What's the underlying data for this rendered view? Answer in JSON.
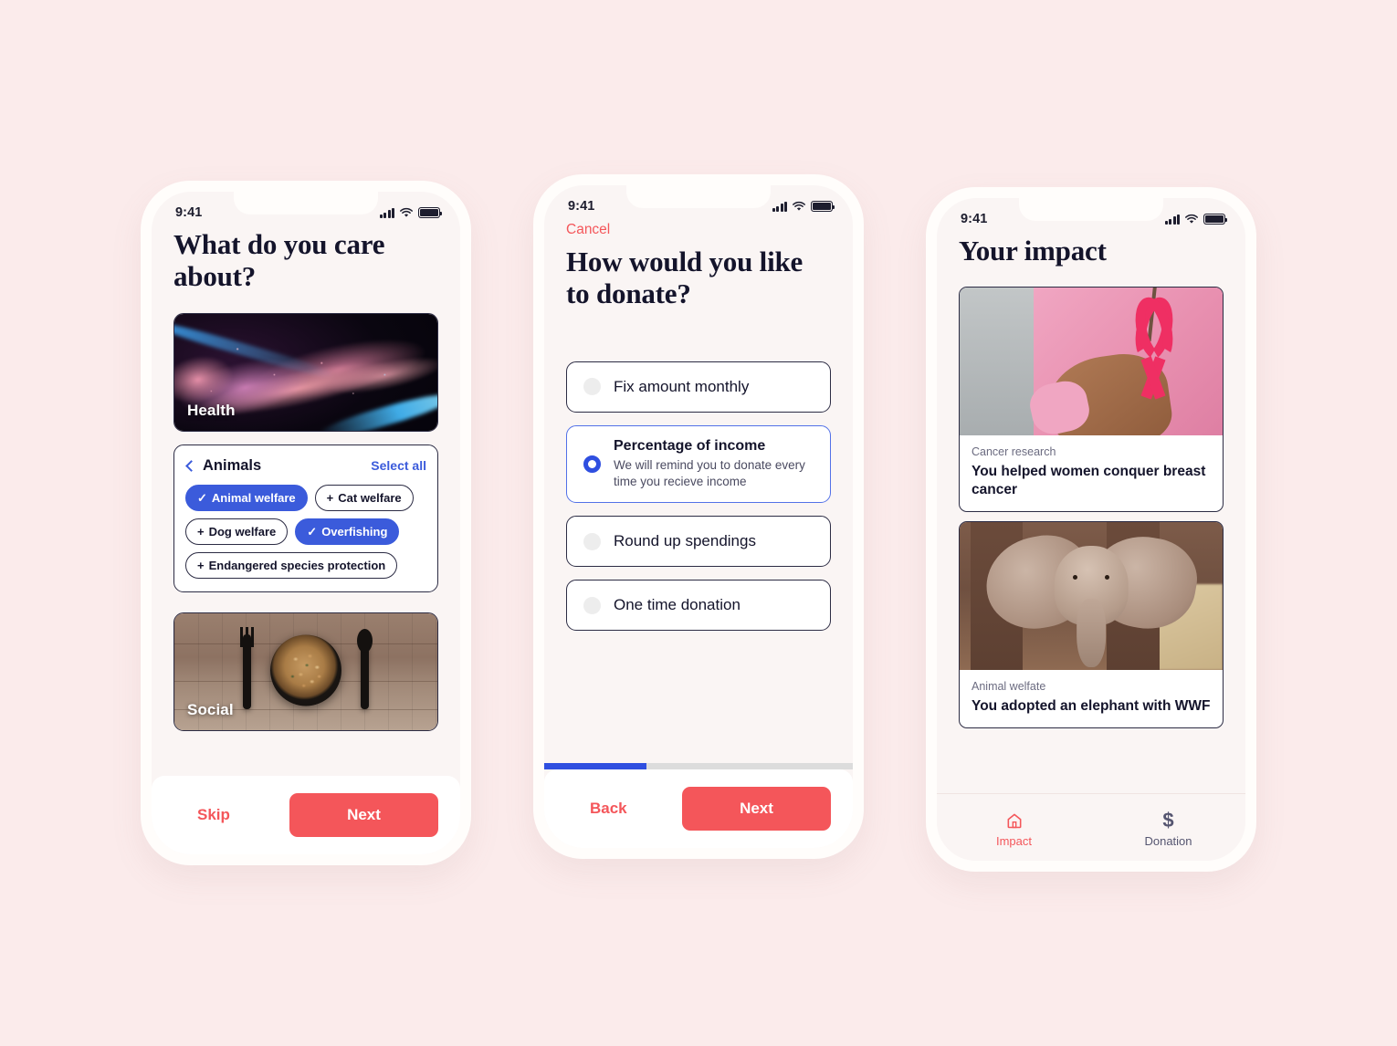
{
  "background_color": "#fbebeb",
  "accent_red": "#f4565a",
  "accent_blue": "#3b5bdb",
  "status_bar": {
    "time": "9:41",
    "signal_icon": "cellular-signal-icon",
    "wifi_icon": "wifi-icon",
    "battery_icon": "battery-icon"
  },
  "screen1": {
    "title": "What do you care about?",
    "cards": [
      {
        "label": "Health",
        "art": "dna-helix"
      },
      {
        "label": "Social",
        "art": "food-bowl"
      }
    ],
    "panel": {
      "back_icon": "chevron-left-icon",
      "title": "Animals",
      "select_all_label": "Select all",
      "chips": [
        {
          "label": "Animal welfare",
          "selected": true,
          "mark": "✓"
        },
        {
          "label": "Cat welfare",
          "selected": false,
          "mark": "+"
        },
        {
          "label": "Dog welfare",
          "selected": false,
          "mark": "+"
        },
        {
          "label": "Overfishing",
          "selected": true,
          "mark": "✓"
        },
        {
          "label": "Endangered species protection",
          "selected": false,
          "mark": "+"
        }
      ]
    },
    "actions": {
      "skip_label": "Skip",
      "next_label": "Next"
    }
  },
  "screen2": {
    "cancel_label": "Cancel",
    "title": "How would you like to donate?",
    "options": [
      {
        "label": "Fix amount monthly",
        "description": "",
        "selected": false
      },
      {
        "label": "Percentage of income",
        "description": "We will remind you to donate every time you recieve income",
        "selected": true
      },
      {
        "label": "Round up spendings",
        "description": "",
        "selected": false
      },
      {
        "label": "One time donation",
        "description": "",
        "selected": false
      }
    ],
    "progress_percent": 33,
    "actions": {
      "back_label": "Back",
      "next_label": "Next"
    }
  },
  "screen3": {
    "title": "Your impact",
    "cards": [
      {
        "category": "Cancer research",
        "title": "You helped women conquer breast cancer",
        "art": "pink-ribbon"
      },
      {
        "category": "Animal welfate",
        "title": "You adopted an elephant with WWF",
        "art": "baby-elephant"
      }
    ],
    "tabs": [
      {
        "label": "Impact",
        "icon": "home-icon",
        "active": true
      },
      {
        "label": "Donation",
        "icon": "dollar-icon",
        "active": false
      }
    ]
  }
}
